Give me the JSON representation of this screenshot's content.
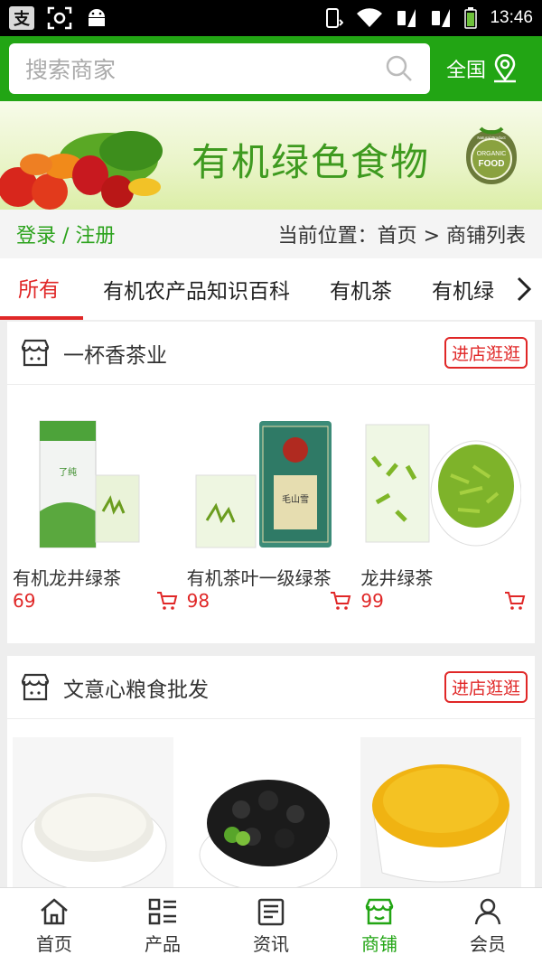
{
  "status_bar": {
    "time": "13:46",
    "alipay_glyph": "支"
  },
  "search": {
    "placeholder": "搜索商家",
    "region_label": "全国"
  },
  "banner": {
    "title": "有机绿色食物",
    "badge_top": "Natural Product",
    "badge_main": "ORGANIC",
    "badge_sub": "FOOD"
  },
  "login_bar": {
    "login_link": "登录 / 注册",
    "breadcrumb": "当前位置：首页 > 商铺列表"
  },
  "tabs": [
    {
      "label": "所有",
      "active": true
    },
    {
      "label": "有机农产品知识百科",
      "active": false
    },
    {
      "label": "有机茶",
      "active": false
    },
    {
      "label": "有机绿",
      "active": false
    }
  ],
  "shops": [
    {
      "name": "一杯香茶业",
      "enter_label": "进店逛逛",
      "products": [
        {
          "name": "有机龙井绿茶",
          "price": "69",
          "image": "tea-can-white"
        },
        {
          "name": "有机茶叶一级绿茶",
          "price": "98",
          "image": "tea-can-green"
        },
        {
          "name": "龙井绿茶",
          "price": "99",
          "image": "tea-leaves-bowl"
        }
      ]
    },
    {
      "name": "文意心粮食批发",
      "enter_label": "进店逛逛",
      "products": [
        {
          "name": "",
          "price": "",
          "image": "white-grain-bowl"
        },
        {
          "name": "",
          "price": "",
          "image": "black-beans-bowl"
        },
        {
          "name": "",
          "price": "",
          "image": "millet-bowl"
        }
      ]
    }
  ],
  "bottom_nav": [
    {
      "label": "首页",
      "icon": "home-icon",
      "active": false
    },
    {
      "label": "产品",
      "icon": "grid-list-icon",
      "active": false
    },
    {
      "label": "资讯",
      "icon": "news-icon",
      "active": false
    },
    {
      "label": "商铺",
      "icon": "store-icon",
      "active": true
    },
    {
      "label": "会员",
      "icon": "user-icon",
      "active": false
    }
  ],
  "colors": {
    "brand_green": "#22a514",
    "accent_red": "#e02727"
  }
}
